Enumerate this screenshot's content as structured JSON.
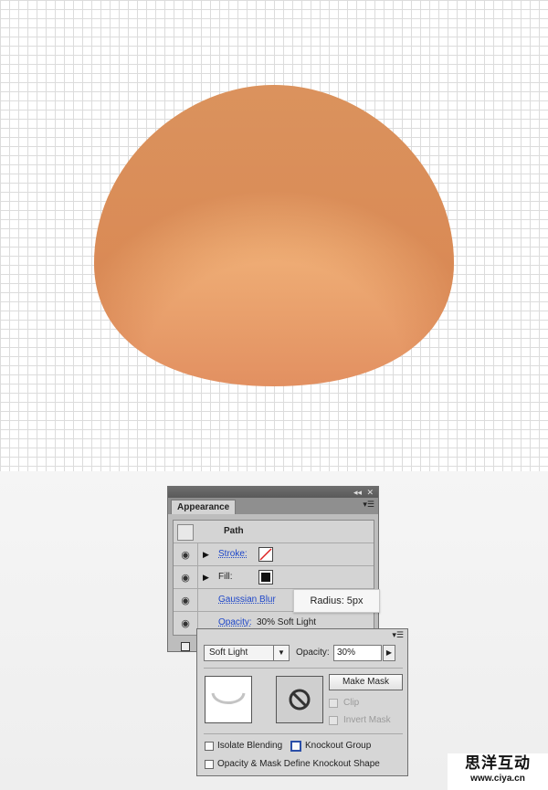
{
  "appearance_panel": {
    "tab": "Appearance",
    "path_label": "Path",
    "rows": {
      "stroke": "Stroke:",
      "fill": "Fill:",
      "effect": "Gaussian Blur",
      "opacity_label": "Opacity:",
      "opacity_value": "30% Soft Light"
    }
  },
  "tooltip": {
    "text": "Radius: 5px"
  },
  "transparency_panel": {
    "blend_mode": "Soft Light",
    "opacity_label": "Opacity:",
    "opacity_value": "30%",
    "make_mask": "Make Mask",
    "clip": "Clip",
    "invert_mask": "Invert Mask",
    "isolate_blending": "Isolate Blending",
    "knockout_group": "Knockout Group",
    "opacity_mask_define": "Opacity & Mask Define Knockout Shape"
  },
  "watermark": {
    "chinese": "思洋互动",
    "url": "www.ciya.cn"
  },
  "colors": {
    "shape_light": "#f2bf85",
    "shape_mid": "#eda56e",
    "shape_dark": "#dd8251",
    "link_blue": "#1d46c9"
  }
}
